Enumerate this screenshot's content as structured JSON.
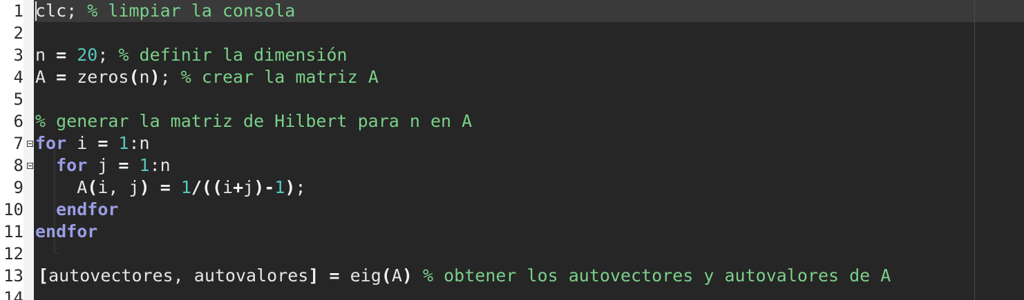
{
  "line_numbers": [
    "1",
    "2",
    "3",
    "4",
    "5",
    "6",
    "7",
    "8",
    "9",
    "10",
    "11",
    "12",
    "13",
    "14"
  ],
  "code": {
    "l1_code": "clc; ",
    "l1_comment": "% limpiar la consola",
    "l3_code_a": "n ",
    "l3_op": "=",
    "l3_space": " ",
    "l3_num": "20",
    "l3_code_b": "; ",
    "l3_comment": "% definir la dimensión",
    "l4_code_a": "A ",
    "l4_op": "=",
    "l4_code_b": " zeros",
    "l4_op2": "(",
    "l4_code_c": "n",
    "l4_op3": ")",
    "l4_code_d": "; ",
    "l4_comment": "% crear la matriz A",
    "l6_comment": "% generar la matriz de Hilbert para n en A",
    "l7_kw": "for",
    "l7_code_a": " i ",
    "l7_op": "=",
    "l7_space": " ",
    "l7_num": "1",
    "l7_code_b": ":n",
    "l8_indent": "  ",
    "l8_kw": "for",
    "l8_code_a": " j ",
    "l8_op": "=",
    "l8_space": " ",
    "l8_num": "1",
    "l8_code_b": ":n",
    "l9_indent": "    ",
    "l9_code_a": "A",
    "l9_op1": "(",
    "l9_code_b": "i, j",
    "l9_op2": ")",
    "l9_space": " ",
    "l9_op3": "=",
    "l9_space2": " ",
    "l9_num1": "1",
    "l9_op4": "/((",
    "l9_code_c": "i",
    "l9_op5": "+",
    "l9_code_d": "j",
    "l9_op6": ")-",
    "l9_num2": "1",
    "l9_op7": ")",
    "l9_code_e": ";",
    "l10_indent": "  ",
    "l10_kw": "endfor",
    "l11_kw": "endfor",
    "l13_op1": "[",
    "l13_code_a": "autovectores, autovalores",
    "l13_op2": "]",
    "l13_space": " ",
    "l13_op3": "=",
    "l13_code_b": " eig",
    "l13_op4": "(",
    "l13_code_c": "A",
    "l13_op5": ")",
    "l13_space2": " ",
    "l13_comment": "% obtener los autovectores y autovalores de A"
  },
  "colors": {
    "background": "#262626",
    "current_line": "#3a3a3a",
    "comment": "#7bd08a",
    "number": "#57c7bd",
    "keyword": "#9a9ee6",
    "text": "#e6e6e6"
  },
  "icons": [
    "fold-collapse-icon"
  ]
}
